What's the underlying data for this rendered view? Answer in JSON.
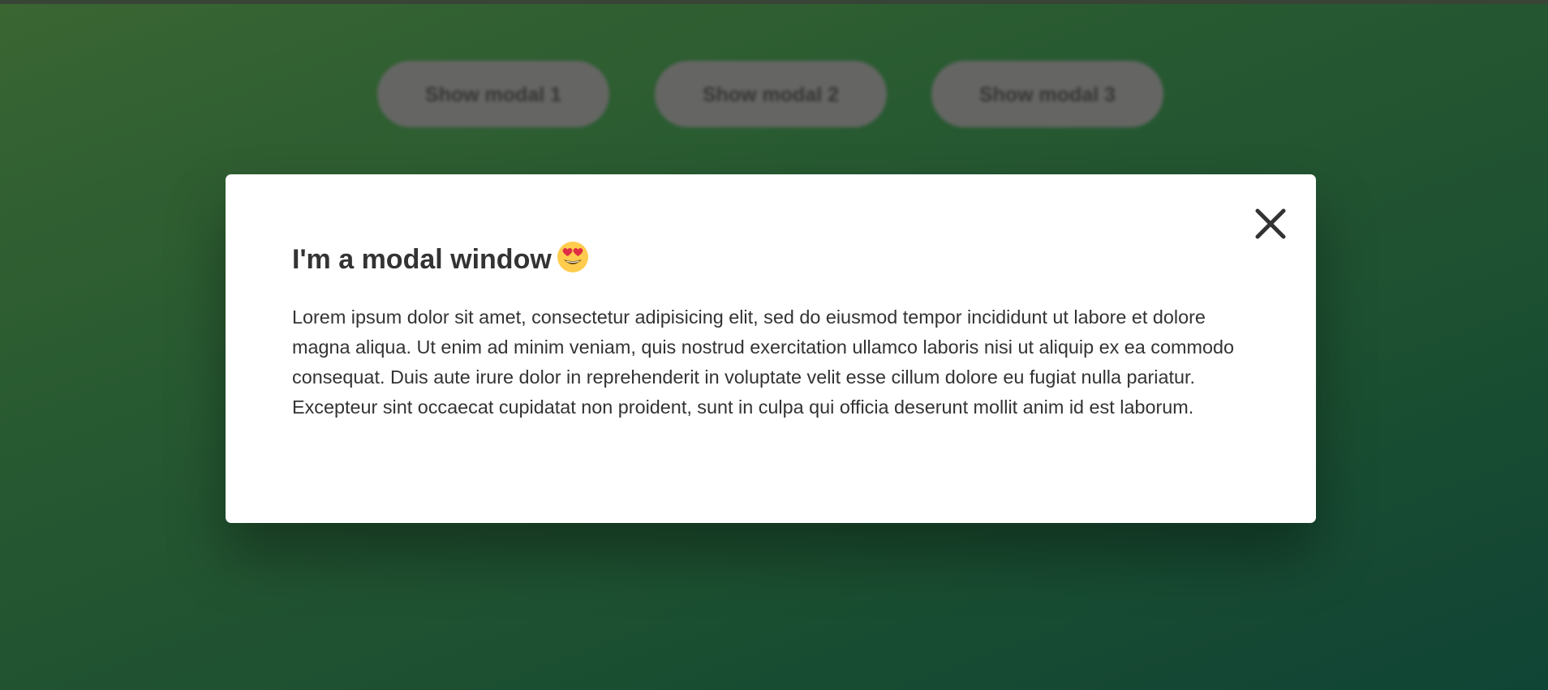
{
  "buttons": [
    {
      "label": "Show modal 1"
    },
    {
      "label": "Show modal 2"
    },
    {
      "label": "Show modal 3"
    }
  ],
  "modal": {
    "title": "I'm a modal window",
    "title_emoji": "heart-eyes-emoji",
    "body": "Lorem ipsum dolor sit amet, consectetur adipisicing elit, sed do eiusmod tempor incididunt ut labore et dolore magna aliqua. Ut enim ad minim veniam, quis nostrud exercitation ullamco laboris nisi ut aliquip ex ea commodo consequat. Duis aute irure dolor in reprehenderit in voluptate velit esse cillum dolore eu fugiat nulla pariatur. Excepteur sint occaecat cupidatat non proident, sunt in culpa qui officia deserunt mollit anim id est laborum.",
    "close_icon": "close-icon"
  },
  "colors": {
    "background_start": "#3f6f37",
    "background_end": "#124a3a",
    "button_bg": "#6e6f6c",
    "modal_bg": "#ffffff",
    "text": "#333333"
  }
}
